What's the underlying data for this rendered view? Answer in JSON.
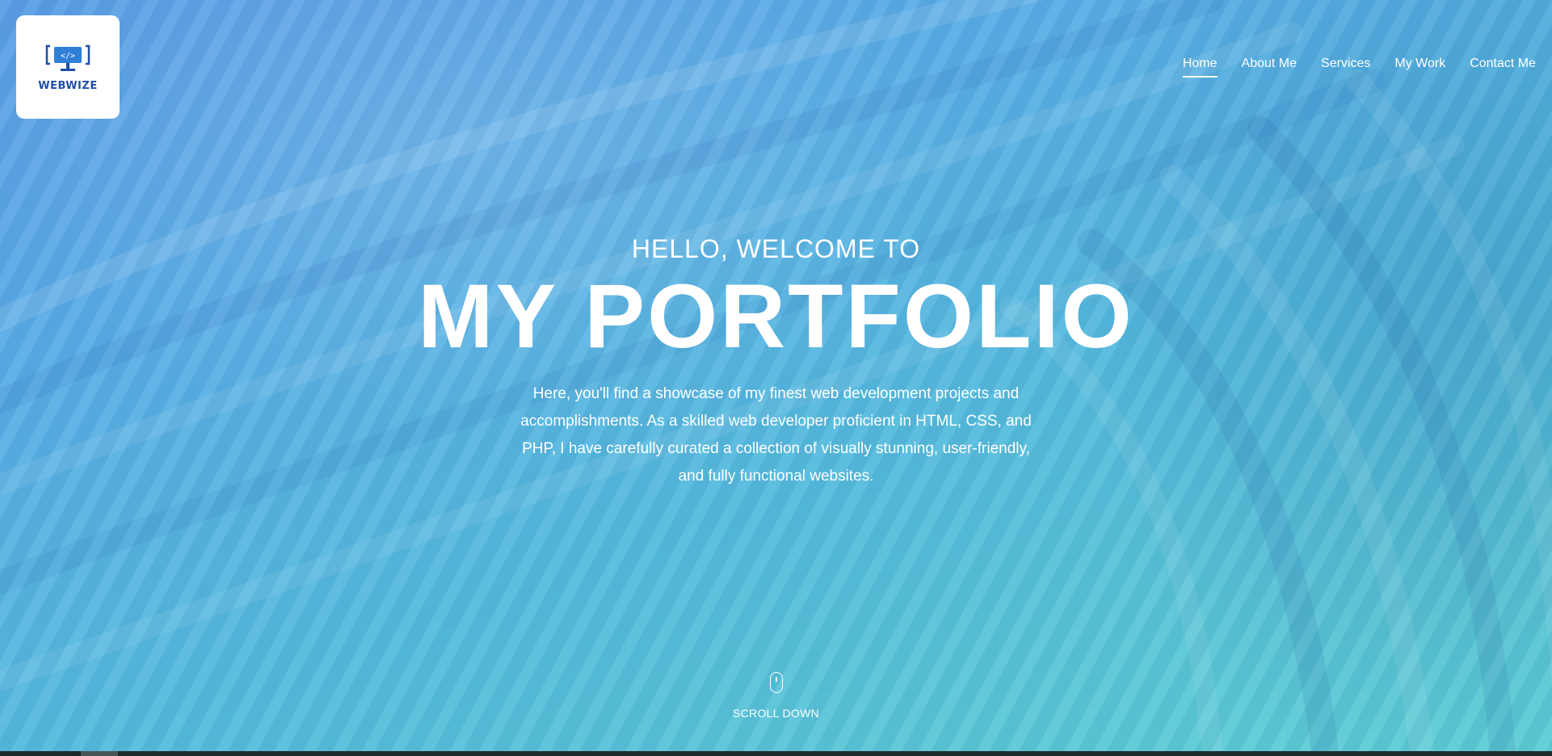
{
  "brand": {
    "logo_text": "WEBWIZE",
    "logo_icon": "monitor-code-icon",
    "accent_color": "#1f4fa6"
  },
  "nav": {
    "items": [
      {
        "label": "Home",
        "active": true
      },
      {
        "label": "About Me",
        "active": false
      },
      {
        "label": "Services",
        "active": false
      },
      {
        "label": "My Work",
        "active": false
      },
      {
        "label": "Contact Me",
        "active": false
      }
    ]
  },
  "hero": {
    "kicker": "HELLO, WELCOME TO",
    "title": "MY PORTFOLIO",
    "description": "Here, you'll find a showcase of my finest web development projects and accomplishments. As a skilled web developer proficient in HTML, CSS, and PHP, I have carefully curated a collection of visually stunning, user-friendly, and fully functional websites.",
    "scroll_label": "SCROLL DOWN",
    "scroll_icon": "mouse-icon"
  },
  "colors": {
    "gradient_top": "#5b9ee6",
    "gradient_bottom": "#5fd0d6",
    "text": "#ffffff"
  }
}
